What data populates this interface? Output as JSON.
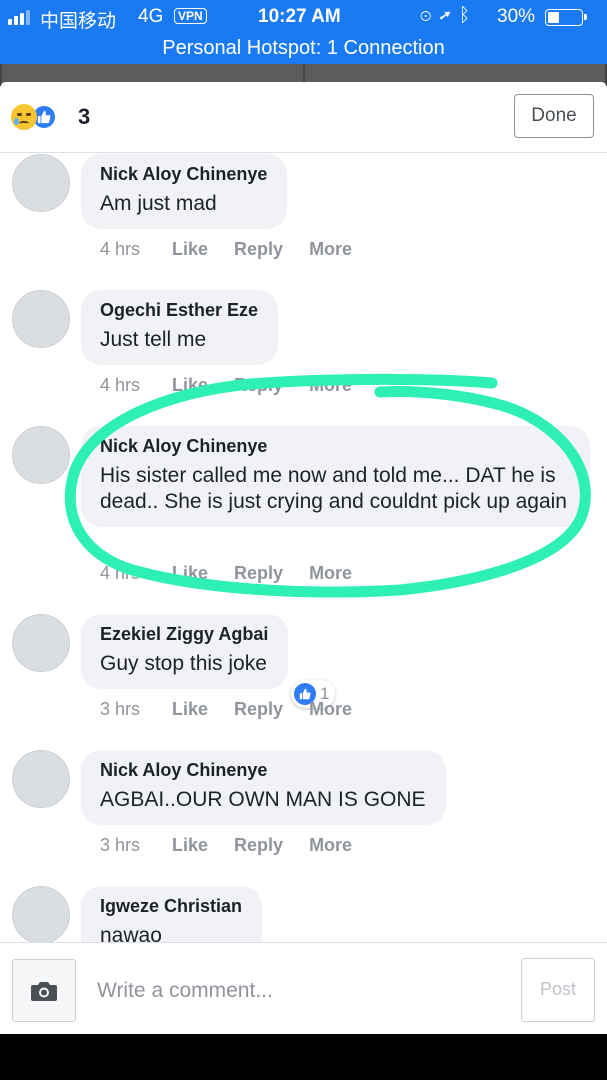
{
  "status_bar": {
    "carrier": "中国移动",
    "network": "4G",
    "vpn": "VPN",
    "time": "10:27 AM",
    "battery": "30%",
    "battery_level": 0.3
  },
  "hotspot": "Personal Hotspot: 1 Connection",
  "header": {
    "reaction_count": "3",
    "done_label": "Done"
  },
  "comments": [
    {
      "author": "Nick Aloy Chinenye",
      "text": "Am just mad",
      "time": "4 hrs"
    },
    {
      "author": "Ogechi Esther Eze",
      "text": "Just tell me",
      "time": "4 hrs"
    },
    {
      "author": "Nick Aloy Chinenye",
      "text": "His sister called me now and told me... DAT he is dead.. She is just crying and couldnt pick up again",
      "time": "4 hrs"
    },
    {
      "author": "Ezekiel Ziggy Agbai",
      "text": "Guy stop this joke",
      "time": "3 hrs",
      "likes": "1"
    },
    {
      "author": "Nick Aloy Chinenye",
      "text": "AGBAI..OUR OWN MAN IS GONE",
      "time": "3 hrs"
    },
    {
      "author": "Igweze Christian",
      "text": "nawao"
    }
  ],
  "actions": {
    "like": "Like",
    "reply": "Reply",
    "more": "More"
  },
  "composer": {
    "placeholder": "Write a comment...",
    "post_label": "Post"
  },
  "colors": {
    "header_blue": "#1a7af4",
    "annotation": "#2ef0b4",
    "like_blue": "#2e7cf6"
  },
  "icons": [
    "camera-icon",
    "like-icon",
    "sad-reaction-icon",
    "location-icon",
    "bluetooth-icon",
    "rotation-lock-icon"
  ]
}
